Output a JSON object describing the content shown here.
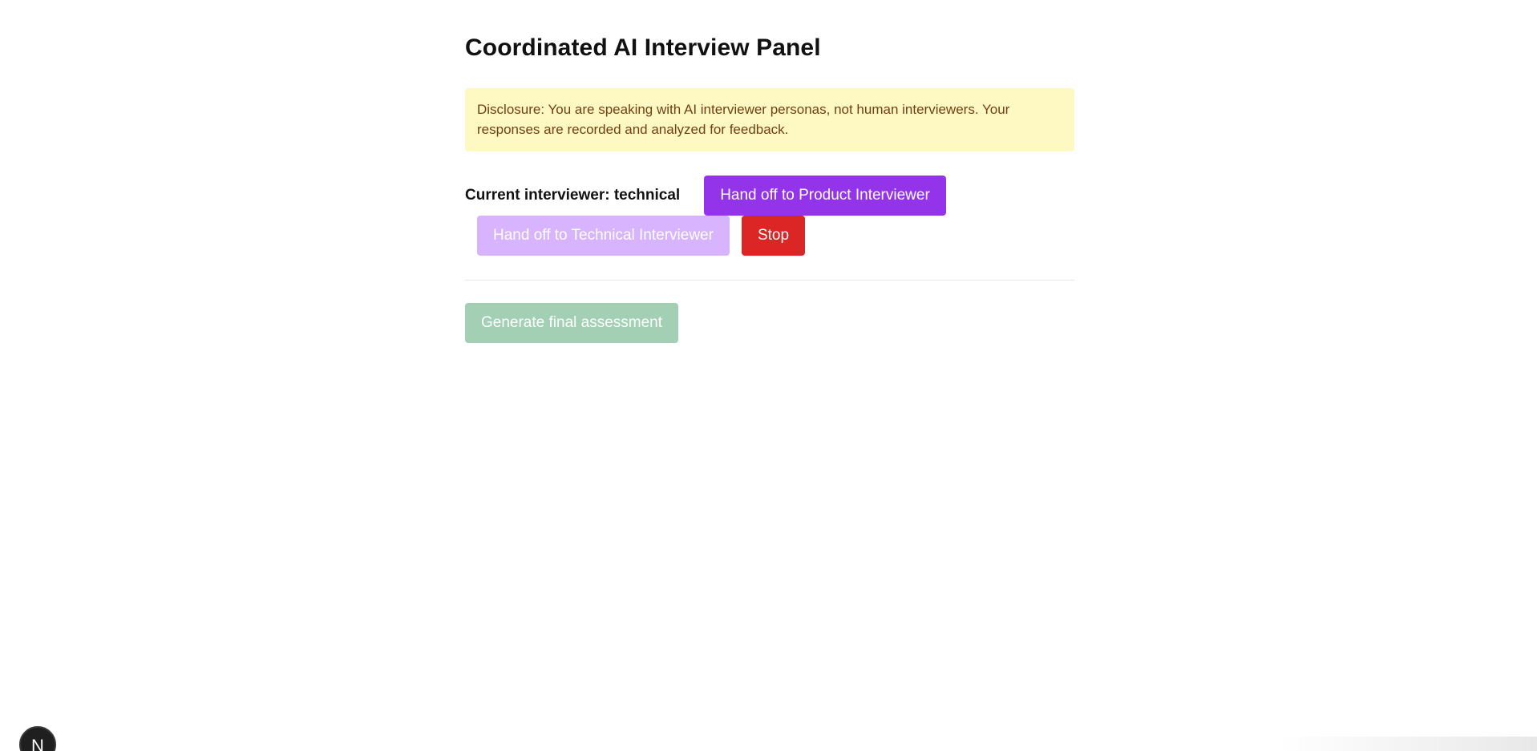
{
  "page": {
    "title": "Coordinated AI Interview Panel",
    "disclosure": "Disclosure: You are speaking with AI interviewer personas, not human interviewers. Your responses are recorded and analyzed for feedback."
  },
  "controls": {
    "current_interviewer_label": "Current interviewer: technical",
    "handoff_product_label": "Hand off to Product Interviewer",
    "handoff_technical_label": "Hand off to Technical Interviewer",
    "stop_label": "Stop"
  },
  "assessment": {
    "generate_label": "Generate final assessment"
  },
  "dev_badge": {
    "letter": "N",
    "icon": "nextjs-logo-icon"
  },
  "colors": {
    "product_button": "#9333ea",
    "technical_button_disabled": "#d8b4fe",
    "stop_button": "#dc2626",
    "assessment_button_disabled": "#a3cfb4",
    "disclosure_background": "#fef9c3",
    "disclosure_text": "#713f12"
  }
}
